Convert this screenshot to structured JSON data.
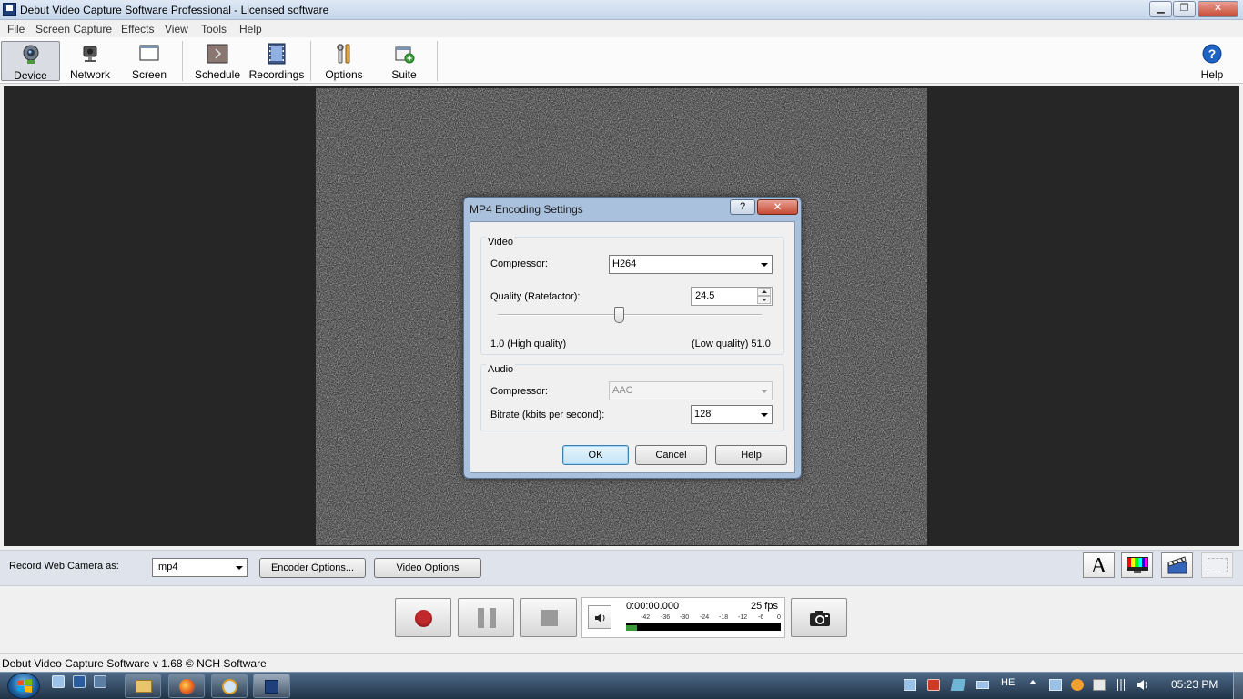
{
  "window": {
    "title": "Debut Video Capture Software Professional - Licensed software",
    "min_glyph": "▁",
    "max_glyph": "❐",
    "close_glyph": "✕"
  },
  "menu": [
    "File",
    "Screen Capture",
    "Effects",
    "View",
    "Tools",
    "Help"
  ],
  "toolbar": {
    "device": "Device",
    "network": "Network",
    "screen": "Screen",
    "schedule": "Schedule",
    "recordings": "Recordings",
    "options": "Options",
    "suite": "Suite",
    "help": "Help"
  },
  "dialog": {
    "title": "MP4 Encoding Settings",
    "help_glyph": "?",
    "close_glyph": "✕",
    "video_group": "Video",
    "video_compressor_label": "Compressor:",
    "video_compressor_value": "H264",
    "quality_label": "Quality (Ratefactor):",
    "quality_value": "24.5",
    "quality_min_label": "1.0 (High quality)",
    "quality_max_label": "(Low quality) 51.0",
    "quality_slider_fraction": 0.46,
    "audio_group": "Audio",
    "audio_compressor_label": "Compressor:",
    "audio_compressor_value": "AAC",
    "bitrate_label": "Bitrate (kbits per second):",
    "bitrate_value": "128",
    "ok": "OK",
    "cancel": "Cancel",
    "help": "Help"
  },
  "record_bar": {
    "label": "Record Web Camera as:",
    "format_value": ".mp4",
    "encoder_options": "Encoder Options...",
    "video_options": "Video Options",
    "text_tool_glyph": "A"
  },
  "transport": {
    "time": "0:00:00.000",
    "fps": "25 fps",
    "meter_ticks": [
      "-42",
      "-36",
      "-30",
      "-24",
      "-18",
      "-12",
      "-6",
      "0"
    ]
  },
  "status": {
    "text": "Debut Video Capture Software v 1.68 © NCH Software"
  },
  "taskbar": {
    "language": "HE",
    "clock": "05:23 PM"
  },
  "colors": {
    "dialog_frame": "#a9c1dd",
    "record_dot": "#c0282c",
    "preview_bg": "#262626",
    "taskbar": "#2c4258"
  }
}
